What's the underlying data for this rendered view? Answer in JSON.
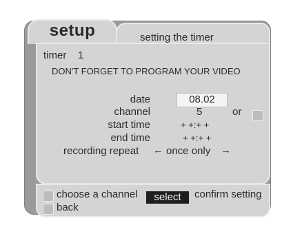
{
  "setup_title": "setup",
  "header": "setting the timer",
  "timer_label": "timer",
  "timer_number": "1",
  "reminder": "DON'T FORGET TO PROGRAM YOUR VIDEO",
  "fields": {
    "date_label": "date",
    "date_value": "08.02",
    "channel_label": "channel",
    "channel_value": "5",
    "channel_or": "or",
    "start_label": "start time",
    "start_value": "+ +:+ +",
    "end_label": "end time",
    "end_value": "+ +:+ +",
    "repeat_label": "recording repeat",
    "repeat_left_arrow": "←",
    "repeat_value": "once only",
    "repeat_right_arrow": "→"
  },
  "footer": {
    "choose_channel": "choose a channel",
    "select": "select",
    "confirm": "confirm setting",
    "back": "back"
  }
}
